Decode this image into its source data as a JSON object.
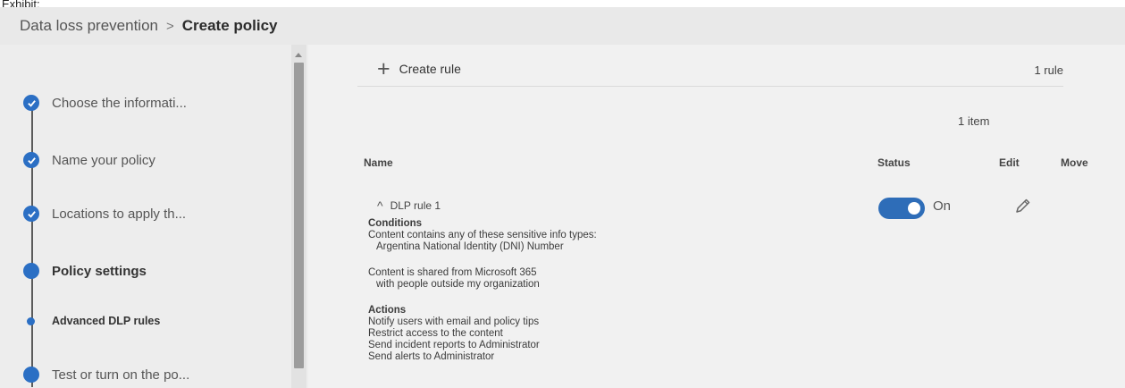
{
  "exhibit_label": "Exhibit:",
  "breadcrumb": {
    "parent": "Data loss prevention",
    "separator": ">",
    "current": "Create policy"
  },
  "steps": [
    {
      "label": "Choose the informati...",
      "state": "completed"
    },
    {
      "label": "Name your policy",
      "state": "completed"
    },
    {
      "label": "Locations to apply th...",
      "state": "completed"
    },
    {
      "label": "Policy settings",
      "state": "current"
    },
    {
      "label": "Advanced DLP rules",
      "state": "current-substep"
    },
    {
      "label": "Test or turn on the po...",
      "state": "pending"
    }
  ],
  "toolbar": {
    "create_rule_label": "Create rule",
    "rule_count": "1 rule"
  },
  "item_count": "1 item",
  "columns": {
    "name": "Name",
    "status": "Status",
    "edit": "Edit",
    "move": "Move"
  },
  "rule": {
    "name": "DLP rule 1",
    "status_label": "On",
    "status_on": true,
    "conditions_heading": "Conditions",
    "condition_1": "Content contains any of these sensitive info types:",
    "condition_1_value": "Argentina National Identity (DNI) Number",
    "condition_2": "Content is shared from Microsoft 365",
    "condition_2_value": "with people outside my organization",
    "actions_heading": "Actions",
    "actions": [
      "Notify users with email and policy tips",
      "Restrict access to the content",
      "Send incident reports to Administrator",
      "Send alerts to Administrator"
    ]
  },
  "colors": {
    "accent": "#2b6fc4",
    "toggle_on": "#2e6db8",
    "background": "#f1f1f1"
  },
  "icons": [
    "check-icon",
    "plus-icon",
    "chevron-up-icon",
    "pencil-icon"
  ]
}
